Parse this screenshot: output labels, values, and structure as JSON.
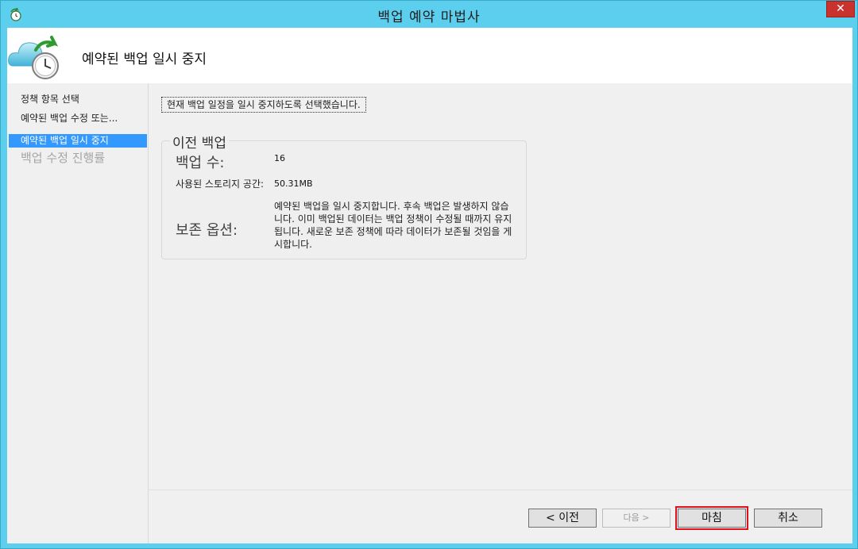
{
  "window": {
    "title": "백업 예약 마법사",
    "close_glyph": "✕",
    "app_icon": "backup-app-icon"
  },
  "header": {
    "title": "예약된 백업 일시 중지",
    "icon": "cloud-clock-icon"
  },
  "sidebar": {
    "items": [
      {
        "label": "정책 항목 선택",
        "state": "normal"
      },
      {
        "label": "예약된 백업 수정 또는...",
        "state": "normal"
      },
      {
        "label": "예약된 백업 일시 중지",
        "state": "active"
      },
      {
        "label": "백업 수정 진행률",
        "state": "disabled"
      }
    ]
  },
  "main": {
    "notice": "현재 백업 일정을 일시 중지하도록 선택했습니다.",
    "group": {
      "title": "이전 백업",
      "backup_count_label": "백업 수:",
      "backup_count_value": "16",
      "storage_label": "사용된 스토리지 공간:",
      "storage_value": "50.31MB",
      "retention_label": "보존 옵션:",
      "retention_text": "예약된 백업을 일시 중지합니다. 후속 백업은 발생하지 않습니다. 이미 백업된 데이터는 백업 정책이 수정될 때까지 유지됩니다. 새로운 보존 정책에 따라 데이터가 보존될 것임을 게시합니다."
    }
  },
  "footer": {
    "prev_label": "< 이전",
    "next_label": "다음 >",
    "finish_label": "마침",
    "cancel_label": "취소"
  },
  "colors": {
    "frame": "#5ccfee",
    "selection": "#3399ff",
    "close_button": "#c9332d",
    "focus_highlight": "#e0101c"
  }
}
